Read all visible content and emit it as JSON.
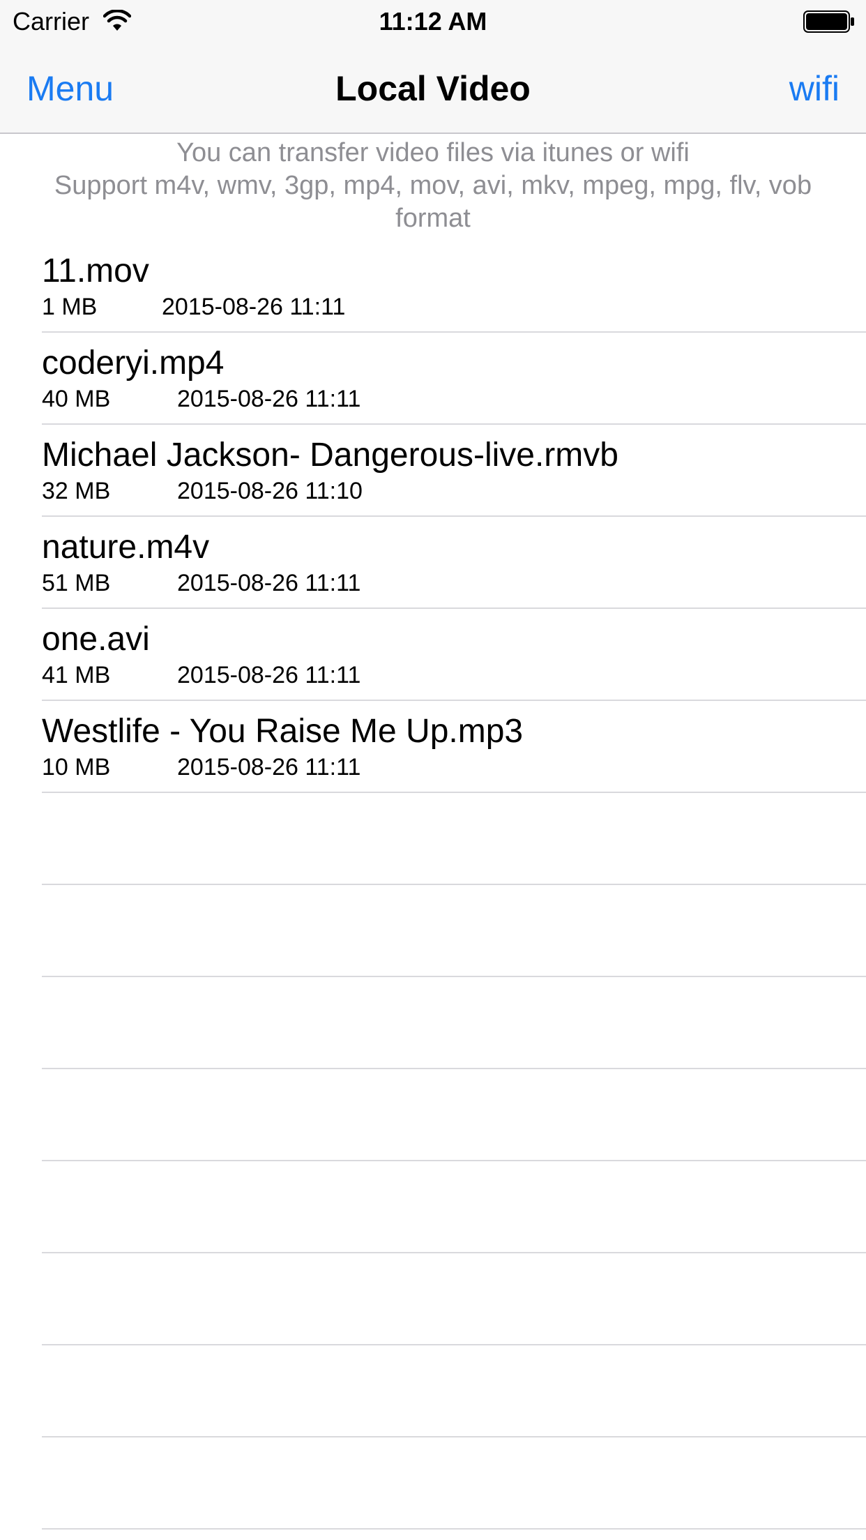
{
  "status_bar": {
    "carrier": "Carrier",
    "time": "11:12 AM",
    "icons": [
      "wifi-icon",
      "battery-icon"
    ]
  },
  "nav": {
    "left_label": "Menu",
    "title": "Local Video",
    "right_label": "wifi"
  },
  "info": {
    "line1": "You can transfer video files via itunes or wifi",
    "line2": "Support m4v, wmv, 3gp, mp4, mov, avi, mkv, mpeg, mpg, flv, vob",
    "line3": "format"
  },
  "files": [
    {
      "name": "11.mov",
      "size": "1 MB",
      "date": "2015-08-26 11:11"
    },
    {
      "name": "coderyi.mp4",
      "size": "40 MB",
      "date": "2015-08-26 11:11"
    },
    {
      "name": "Michael Jackson- Dangerous-live.rmvb",
      "size": "32 MB",
      "date": "2015-08-26 11:10"
    },
    {
      "name": "nature.m4v",
      "size": "51 MB",
      "date": "2015-08-26 11:11"
    },
    {
      "name": "one.avi",
      "size": "41 MB",
      "date": "2015-08-26 11:11"
    },
    {
      "name": "Westlife - You Raise Me Up.mp3",
      "size": "10 MB",
      "date": "2015-08-26 11:11"
    }
  ],
  "colors": {
    "accent": "#1a7bf2",
    "subtitle": "#8e8e93",
    "separator": "#d9d9dd",
    "bar_background": "#f7f7f7"
  }
}
